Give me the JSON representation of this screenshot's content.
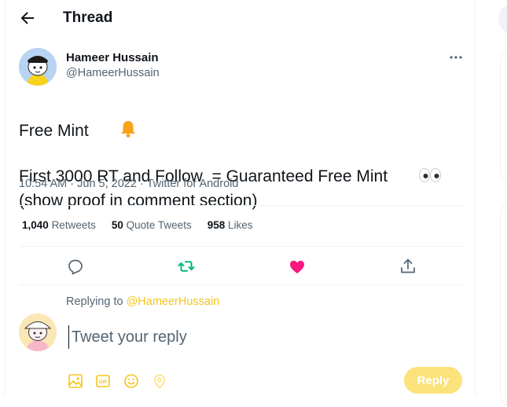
{
  "header": {
    "title": "Thread"
  },
  "tweet": {
    "author_name": "Hameer Hussain",
    "author_handle": "@HameerHussain",
    "lines": [
      "Free Mint",
      "First 3000 RT and Follow  = Guaranteed Free Mint",
      "(show proof in comment section)"
    ],
    "timestamp": "10:54 AM · Jun 5, 2022",
    "separator": " · ",
    "source": "Twitter for Android",
    "stats": {
      "retweets_count": "1,040",
      "retweets_label": "Retweets",
      "quotes_count": "50",
      "quotes_label": "Quote Tweets",
      "likes_count": "958",
      "likes_label": "Likes"
    }
  },
  "reply": {
    "replying_to_label": "Replying to",
    "replying_to_handle": "@HameerHussain",
    "placeholder": "Tweet your reply",
    "button_label": "Reply"
  },
  "icons": {
    "back": "arrow-left-icon",
    "more": "more-dots-icon",
    "bell": "bell-emoji",
    "eyes": "eyes-emoji",
    "reply": "reply-icon",
    "retweet": "retweet-icon",
    "like": "heart-icon",
    "share": "share-icon",
    "media": "image-icon",
    "gif": "gif-icon",
    "emoji": "emoji-icon",
    "location": "location-icon"
  },
  "colors": {
    "accent": "#f5c518",
    "retweet": "#00ba7c",
    "like": "#f91880",
    "reply_button_bg": "#fbe27a",
    "muted_text": "#536471"
  }
}
